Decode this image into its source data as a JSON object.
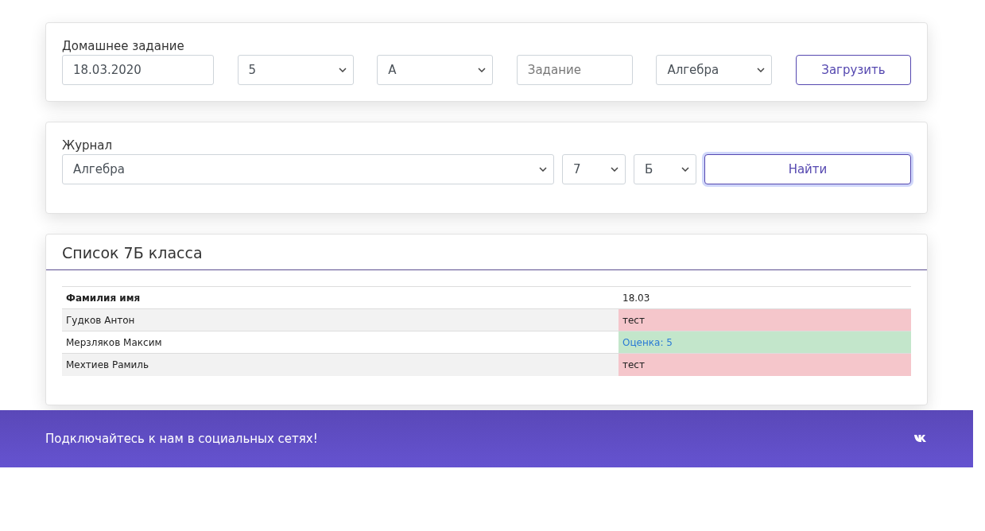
{
  "homework": {
    "title": "Домашнее задание",
    "date": "18.03.2020",
    "grade_select": "5",
    "letter_select": "А",
    "task": {
      "placeholder": "Задание"
    },
    "subject_select": "Алгебра",
    "upload_button": "Загрузить"
  },
  "journal": {
    "title": "Журнал",
    "subject_select": "Алгебра",
    "grade_select": "7",
    "letter_select": "Б",
    "find_button": {
      "label": "Найти",
      "focused": true
    }
  },
  "class_list": {
    "title": "Список 7Б класса",
    "columns": [
      "Фамилия имя",
      "18.03"
    ],
    "rows": [
      {
        "name": "Гудков Антон",
        "mark": {
          "kind": "note",
          "text": "тест"
        }
      },
      {
        "name": "Мерзляков Максим",
        "mark": {
          "kind": "grade",
          "text": "Оценка: 5"
        }
      },
      {
        "name": "Мехтиев Рамиль",
        "mark": {
          "kind": "note",
          "text": "тест"
        }
      }
    ]
  },
  "footer": {
    "text": "Подключайтесь к нам в социальных сетях!"
  }
}
